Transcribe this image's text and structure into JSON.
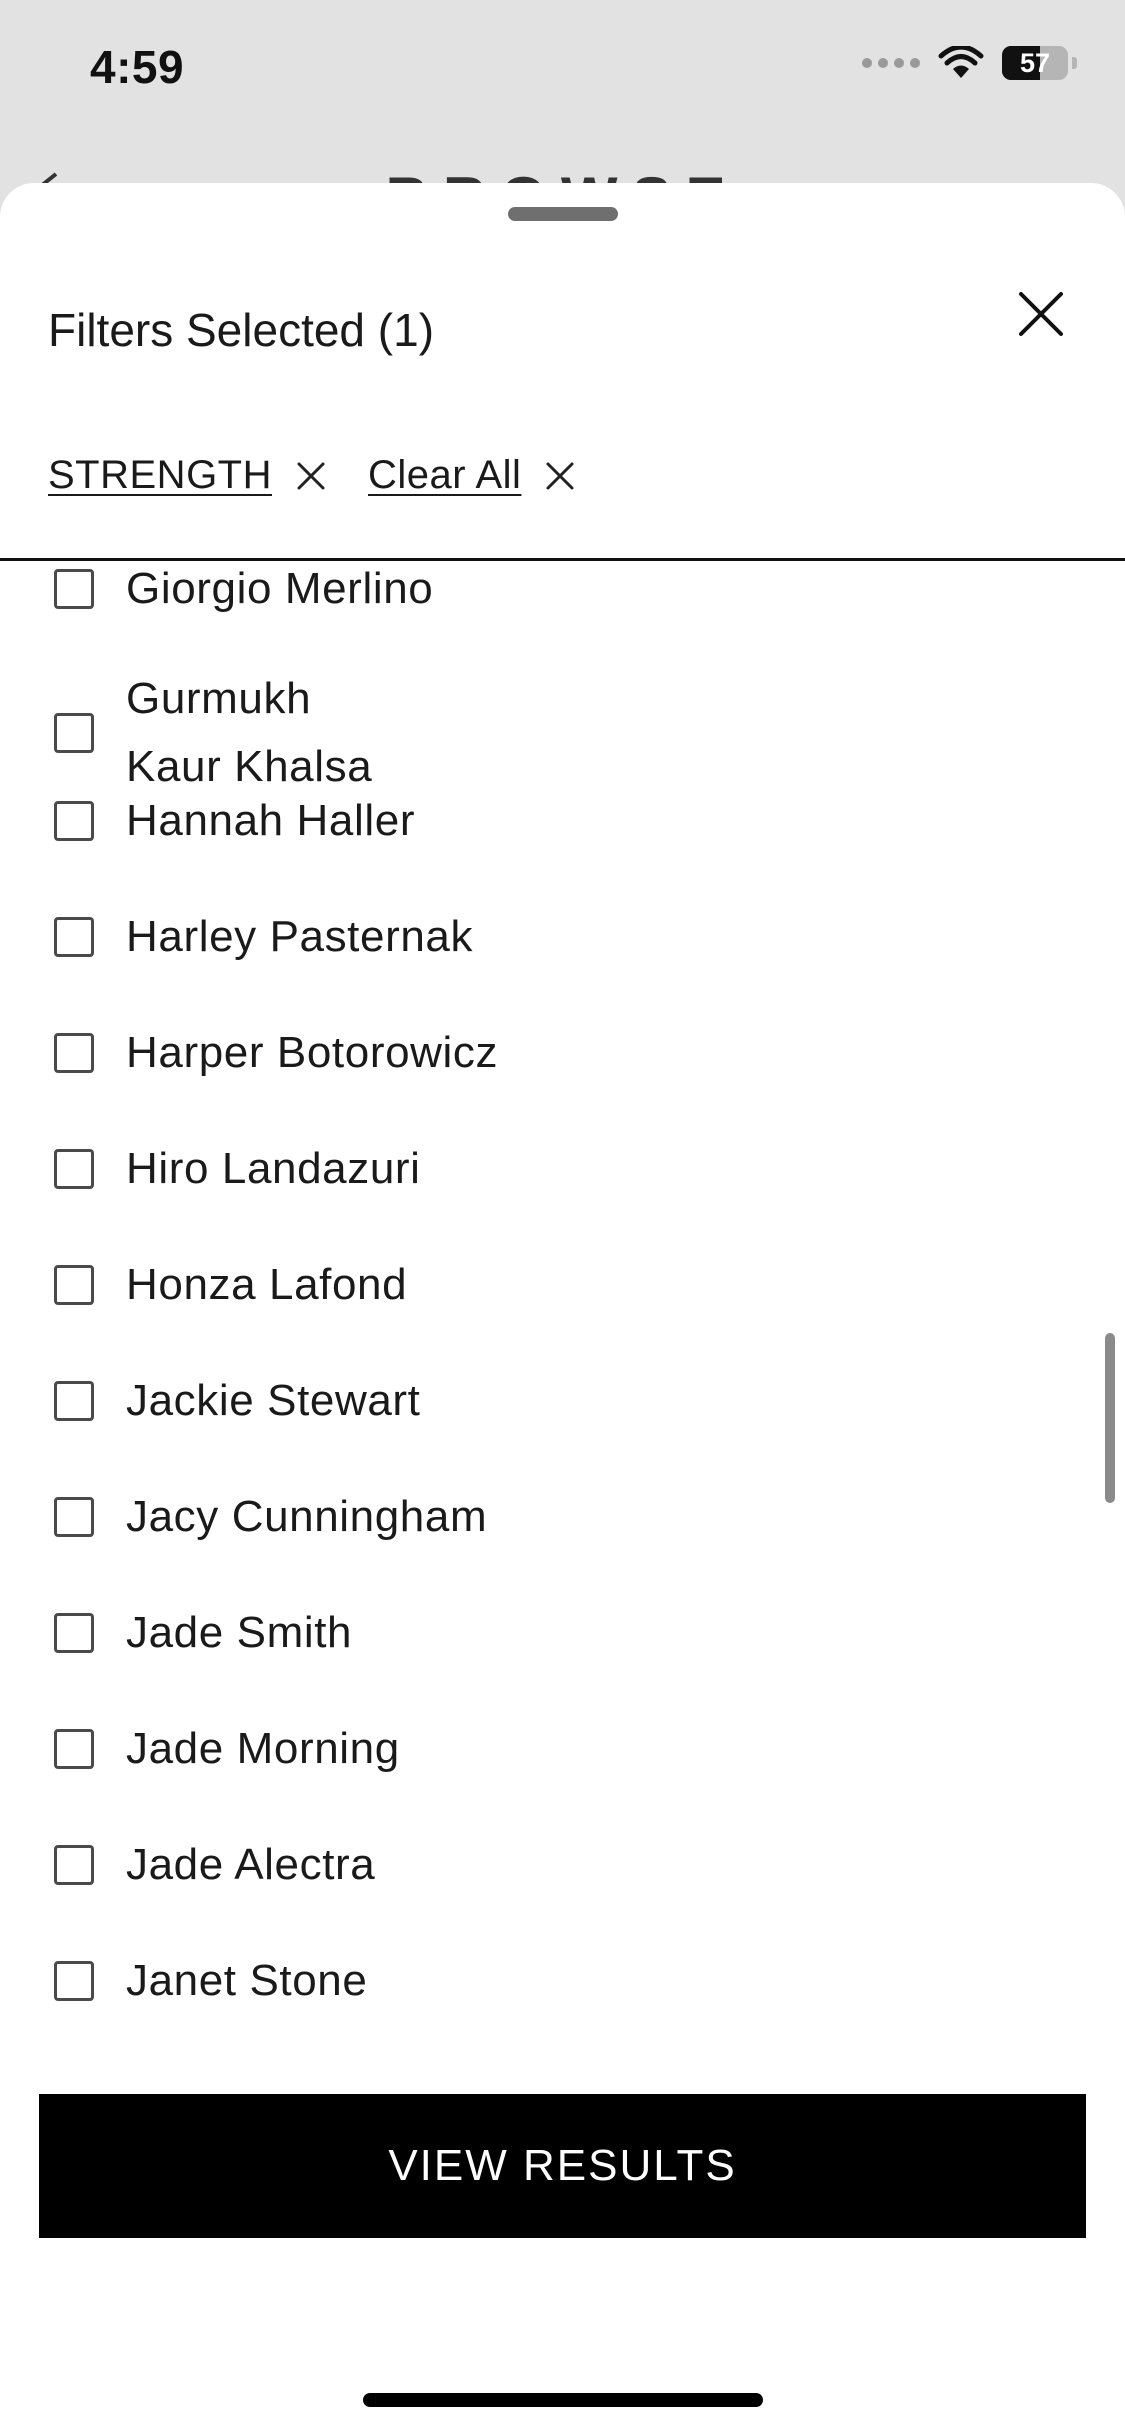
{
  "status_bar": {
    "time": "4:59",
    "battery": "57",
    "battery_level": 0.57
  },
  "background_header": {
    "title": "BROWSE"
  },
  "sheet": {
    "title": "Filters Selected (1)",
    "chips": [
      {
        "label": "STRENGTH"
      },
      {
        "label": "Clear All"
      }
    ],
    "items": [
      {
        "label": "Giorgio Merlino",
        "checked": false
      },
      {
        "label": "Gurmukh\nKaur Khalsa",
        "checked": false
      },
      {
        "label": "Hannah Haller",
        "checked": false
      },
      {
        "label": "Harley Pasternak",
        "checked": false
      },
      {
        "label": "Harper Botorowicz",
        "checked": false
      },
      {
        "label": "Hiro Landazuri",
        "checked": false
      },
      {
        "label": "Honza Lafond",
        "checked": false
      },
      {
        "label": "Jackie Stewart",
        "checked": false
      },
      {
        "label": "Jacy Cunningham",
        "checked": false
      },
      {
        "label": "Jade Smith",
        "checked": false
      },
      {
        "label": "Jade Morning",
        "checked": false
      },
      {
        "label": "Jade Alectra",
        "checked": false
      },
      {
        "label": "Janet Stone",
        "checked": false
      }
    ],
    "view_results_label": "VIEW RESULTS"
  }
}
